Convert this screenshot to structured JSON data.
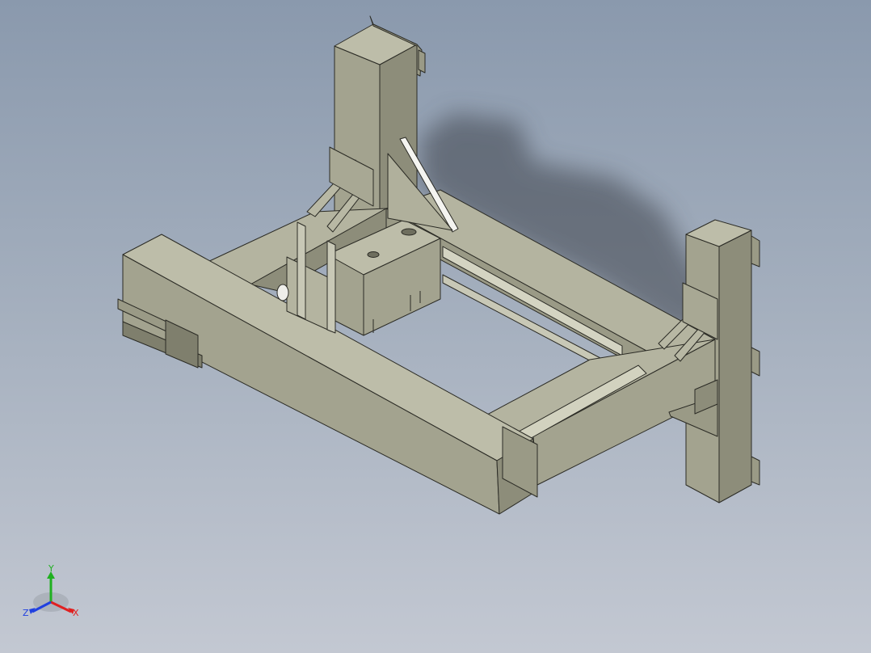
{
  "viewport": {
    "background_top": "#8a99ad",
    "background_bottom": "#c3c8d2"
  },
  "model": {
    "part_color": "#a3a38f",
    "part_shade": "#7f7f6d",
    "part_light": "#bdbda9",
    "edge_color": "#2b2b25",
    "shadow_color": "#3e434b"
  },
  "triad": {
    "x_label": "X",
    "y_label": "Y",
    "z_label": "Z",
    "x_color": "#e02020",
    "y_color": "#20b020",
    "z_color": "#2040e0"
  }
}
